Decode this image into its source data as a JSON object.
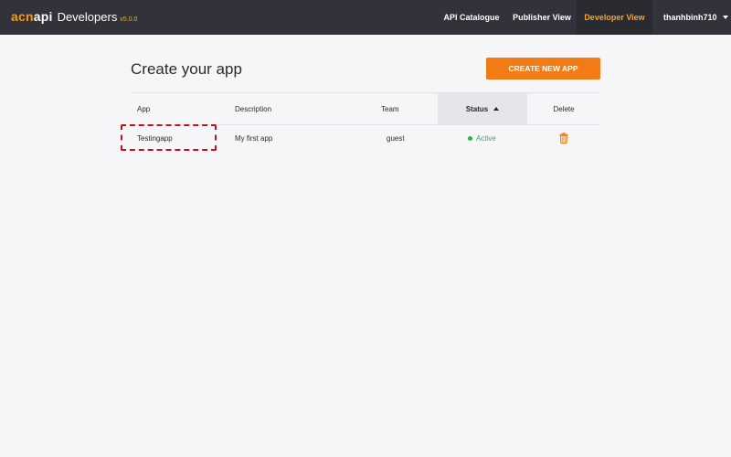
{
  "brand": {
    "logo_acn": "acn",
    "logo_api": "api",
    "name": "Developers",
    "version": "v5.0.0"
  },
  "nav": {
    "catalogue": "API Catalogue",
    "publisher": "Publisher View",
    "developer": "Developer View",
    "user": "thanhbinh710"
  },
  "page": {
    "title": "Create your app",
    "create_button": "CREATE NEW APP"
  },
  "table": {
    "headers": {
      "app": "App",
      "description": "Description",
      "team": "Team",
      "status": "Status",
      "delete": "Delete"
    },
    "rows": [
      {
        "app": "Testingapp",
        "description": "My first app",
        "team": "guest",
        "status": "Active"
      }
    ]
  },
  "colors": {
    "accent": "#f37b16",
    "navbar": "#32323a",
    "active_status": "#2eb150",
    "highlight": "#c0121d"
  },
  "icons": {
    "user_menu": "caret-down-icon",
    "sort": "sort-ascending-icon",
    "delete": "trash-icon",
    "status": "status-dot-icon"
  }
}
